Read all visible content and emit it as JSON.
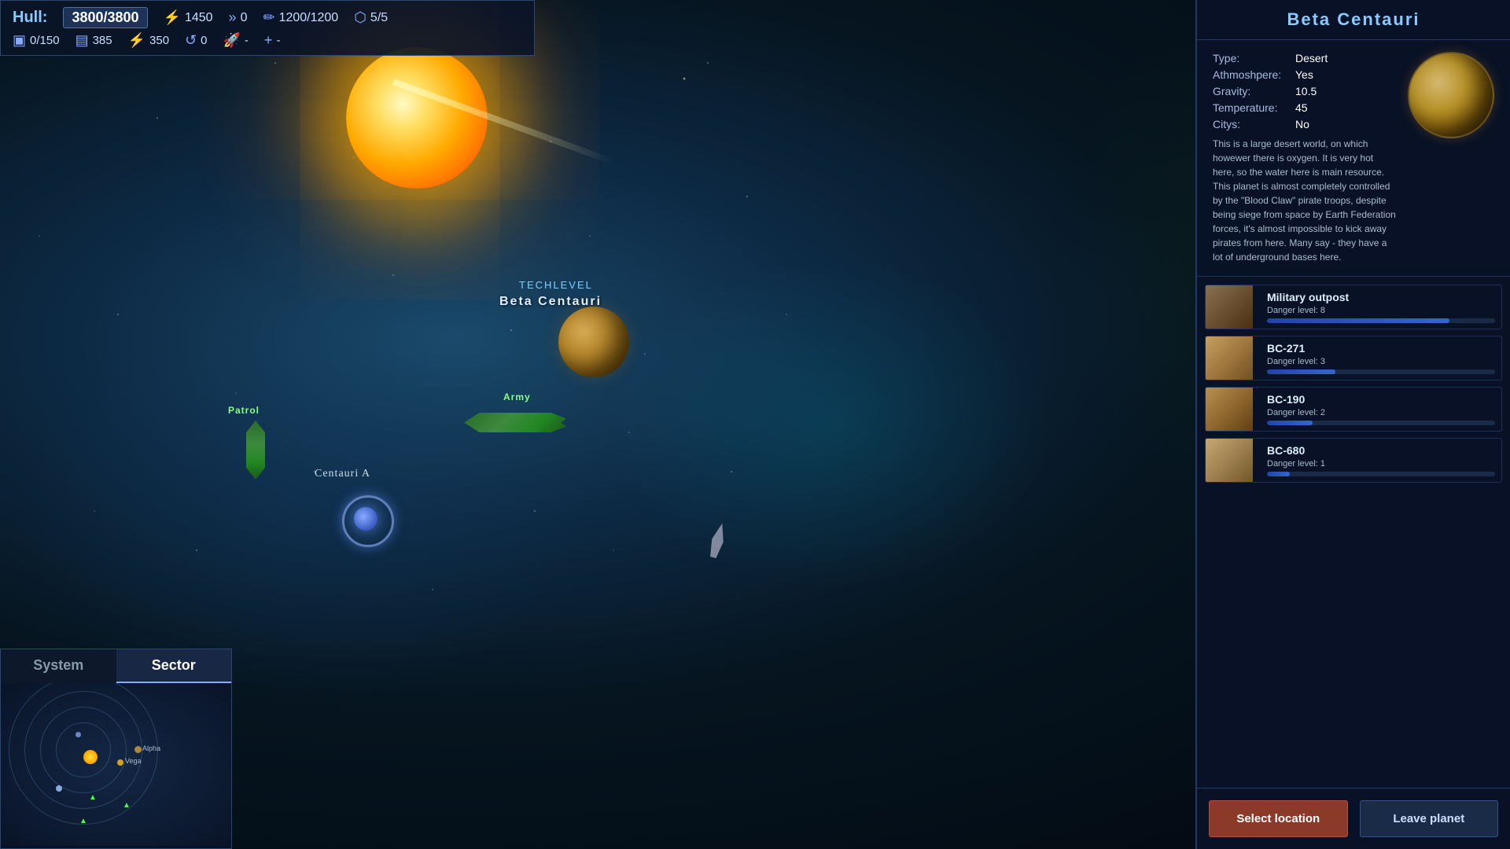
{
  "hud": {
    "hull_label": "Hull:",
    "hull_value": "3800/3800",
    "stats": [
      {
        "icon": "⚡",
        "value": "1450"
      },
      {
        "icon": "»",
        "value": "0"
      },
      {
        "icon": "✏",
        "value": "1200/1200"
      },
      {
        "icon": "⬡",
        "value": "5/5"
      }
    ],
    "stats2": [
      {
        "icon": "▣",
        "value": "0/150"
      },
      {
        "icon": "▤",
        "value": "385"
      },
      {
        "icon": "⚡",
        "value": "350"
      },
      {
        "icon": "↺",
        "value": "0"
      },
      {
        "icon": "🚀",
        "value": "-"
      },
      {
        "icon": "+",
        "value": "-"
      }
    ]
  },
  "planet": {
    "title": "Beta Centauri",
    "type_label": "Type:",
    "type_value": "Desert",
    "atmosphere_label": "Athmoshpere:",
    "atmosphere_value": "Yes",
    "gravity_label": "Gravity:",
    "gravity_value": "10.5",
    "temperature_label": "Temperature:",
    "temperature_value": "45",
    "citys_label": "Citys:",
    "citys_value": "No",
    "description": "This is a large desert world, on which howewer there is oxygen. It is very hot here, so the water here is main resource. This planet is almost completely controlled by the \"Blood Claw\" pirate troops, despite being siege from space by Earth Federation forces, it's almost impossible to kick away pirates from here. Many say - they have a lot of underground bases here."
  },
  "locations": [
    {
      "name": "Military outpost",
      "danger_label": "Danger level: 8",
      "danger_pct": 80
    },
    {
      "name": "BC-271",
      "danger_label": "Danger level: 3",
      "danger_pct": 30
    },
    {
      "name": "BC-190",
      "danger_label": "Danger level: 2",
      "danger_pct": 20
    },
    {
      "name": "BC-680",
      "danger_label": "Danger level: 1",
      "danger_pct": 10
    }
  ],
  "buttons": {
    "select_location": "Select location",
    "leave_planet": "Leave planet"
  },
  "minimap": {
    "tab_system": "System",
    "tab_sector": "Sector",
    "active_tab": "Sector"
  },
  "scene": {
    "tech_level_label": "TechLevel",
    "planet_name_label": "Beta Centauri",
    "army_label": "Army",
    "patrol_label": "Patrol",
    "centauri_a_label": "Centauri A"
  }
}
